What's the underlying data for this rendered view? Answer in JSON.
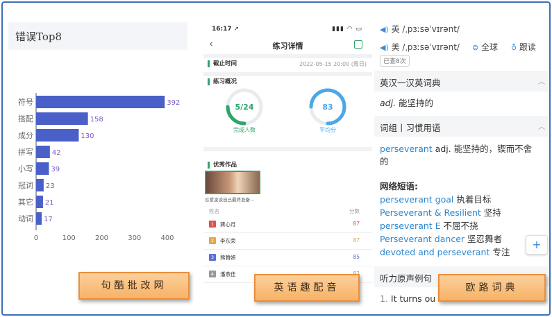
{
  "panel1": {
    "title": "错误Top8",
    "chart_data": {
      "type": "bar",
      "orientation": "horizontal",
      "title": "错误Top8",
      "categories": [
        "符号",
        "搭配",
        "成分",
        "拼写",
        "小写",
        "冠词",
        "其它",
        "动词"
      ],
      "values": [
        392,
        158,
        130,
        42,
        39,
        23,
        21,
        17
      ],
      "xticks": [
        "0",
        "100",
        "200",
        "300",
        "400"
      ],
      "xlim": [
        0,
        400
      ],
      "grid": false,
      "legend": "none",
      "bar_color": "#4a5fc8",
      "label_color": "#7b57c2"
    }
  },
  "panel2": {
    "status_time": "16:17 ➚",
    "status_right": "▮▮▮ ◠ ▭",
    "nav_back": "‹",
    "nav_title": "练习详情",
    "deadline_label": "截止时间",
    "deadline_value": "2022-05-15 20:00 (周日)",
    "overview_label": "练习概况",
    "ring1_value": "5/24",
    "ring1_label": "完成人数",
    "ring2_value": "83",
    "ring2_label": "平均分",
    "works_label": "优秀作品",
    "thumb_caption": "谷爱凌谈自己最终准备...",
    "table_name_header": "姓名",
    "table_score_header": "分数",
    "rows": [
      {
        "rank": "1",
        "name": "龚心月",
        "score": "87",
        "color": "#d9534f",
        "score_color": "#d9534f"
      },
      {
        "rank": "2",
        "name": "李东荣",
        "score": "87",
        "color": "#e0a84a",
        "score_color": "#e0a84a"
      },
      {
        "rank": "3",
        "name": "熊贊妍",
        "score": "85",
        "color": "#5b6fd0",
        "score_color": "#5b6fd0"
      },
      {
        "rank": "4",
        "name": "潘燕佳",
        "score": "82",
        "color": "#999999",
        "score_color": "#999999"
      }
    ],
    "accent": "#2ea56b",
    "ring1_color": "#2ea56b",
    "ring2_color": "#4aa8e8"
  },
  "panel3": {
    "pron_uk": "英 /ˌpɜːsəˈvɪrənt/",
    "pron_us": "美 /ˌpɜːsəˈvɪrənt/",
    "global_btn": "全球",
    "follow_btn": "跟读",
    "badge": "已查8次",
    "dict_section": "英汉一汉英词典",
    "definition_pos": "adj.",
    "definition_text": "能坚持的",
    "phrase_section": "词组丨习惯用语",
    "phrase_word": "perseverant",
    "phrase_def_line1": "adj. 能坚持的，锲而不舍",
    "phrase_def_line2": "的",
    "net_title": "网络短语:",
    "net_phrases": [
      {
        "en": "perseverant goal",
        "zh": "执着目标"
      },
      {
        "en": "Perseverant & Resilient",
        "zh": "坚持"
      },
      {
        "en": "perseverant E",
        "zh": "不屈不挠"
      },
      {
        "en": "Perseverant dancer",
        "zh": "坚忍舞者"
      },
      {
        "en": "devoted and perseverant",
        "zh": "专注"
      }
    ],
    "listen_section": "听力原声例句",
    "example_prefix": "1.",
    "example_text": "It turns ou",
    "plus": "+"
  },
  "banners": {
    "b1": "句酷批改网",
    "b2": "英语趣配音",
    "b3": "欧路词典"
  }
}
